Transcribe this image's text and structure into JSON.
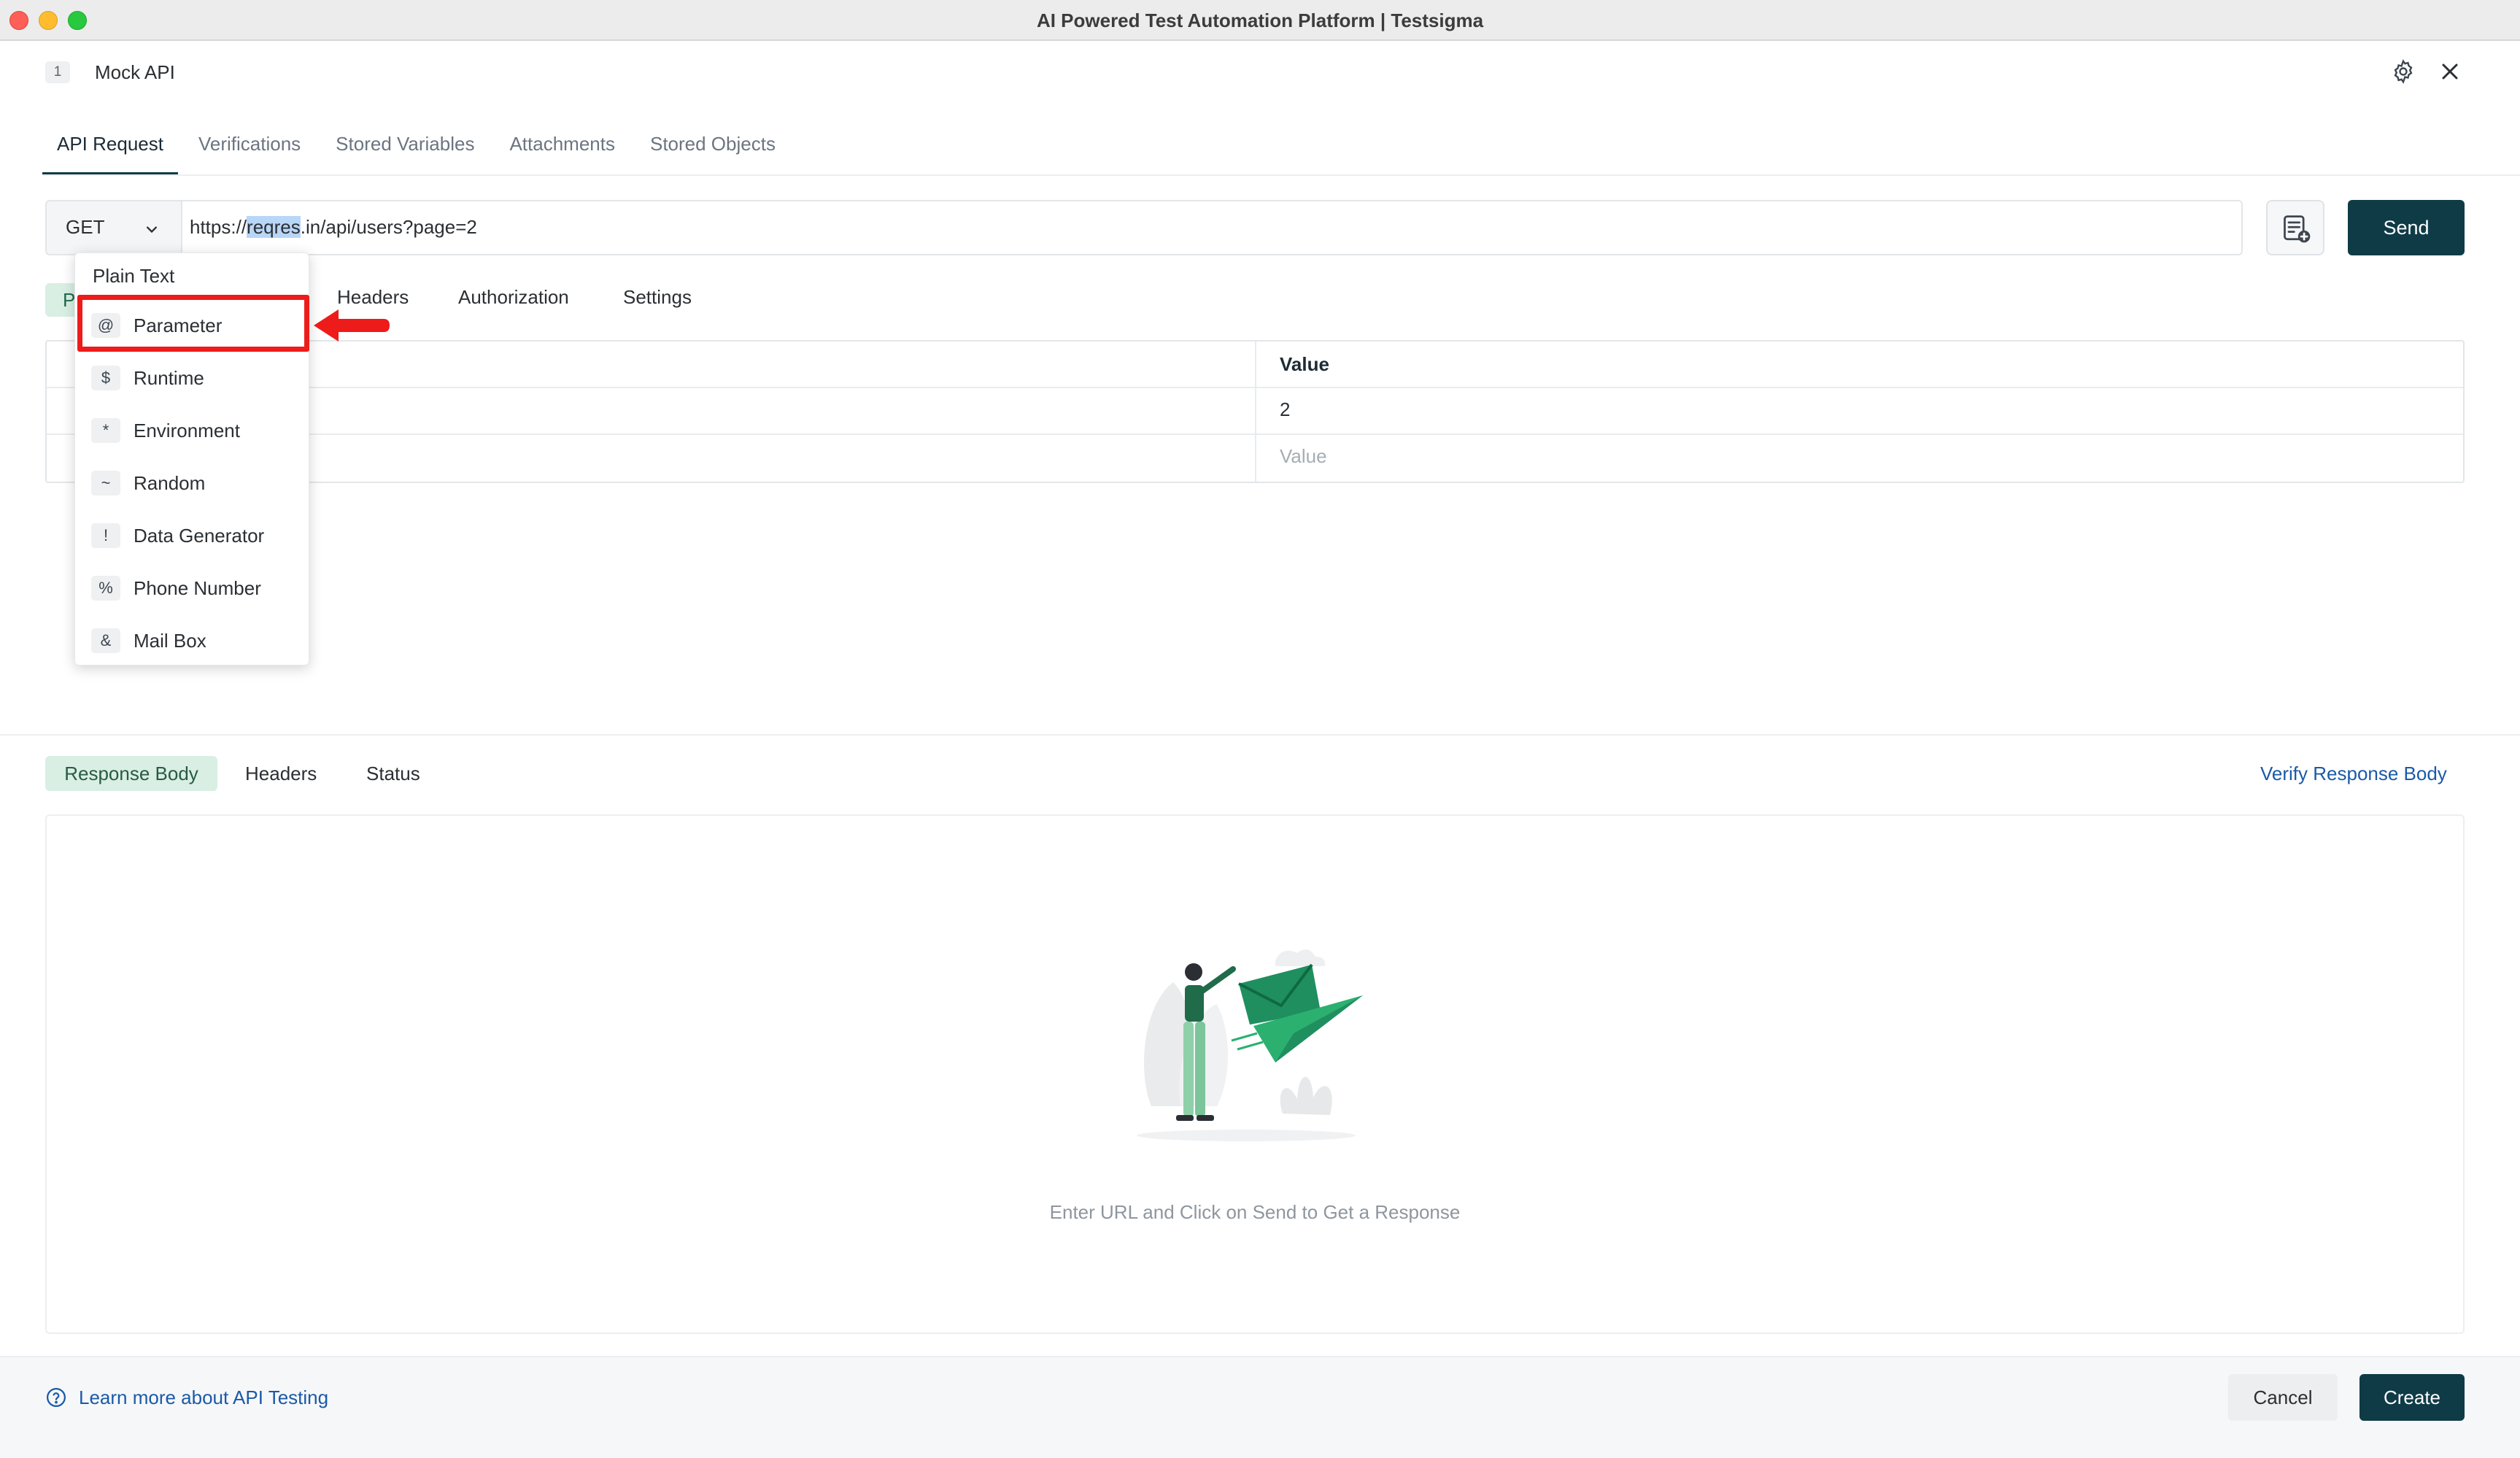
{
  "window": {
    "title": "AI Powered Test Automation Platform | Testsigma"
  },
  "header": {
    "step_number": "1",
    "step_title": "Mock API"
  },
  "main_tabs": [
    {
      "label": "API Request"
    },
    {
      "label": "Verifications"
    },
    {
      "label": "Stored Variables"
    },
    {
      "label": "Attachments"
    },
    {
      "label": "Stored Objects"
    }
  ],
  "request": {
    "method": "GET",
    "url_prefix": "https://",
    "url_selected": "reqres",
    "url_suffix": ".in/api/users?page=2",
    "send_label": "Send"
  },
  "sub_tabs": {
    "params_peek": "P",
    "headers": "Headers",
    "authorization": "Authorization",
    "settings": "Settings"
  },
  "params_table": {
    "value_header": "Value",
    "rows": [
      {
        "value": "2"
      }
    ],
    "value_placeholder": "Value"
  },
  "dropdown": {
    "header": "Plain Text",
    "items": [
      {
        "glyph": "@",
        "label": "Parameter"
      },
      {
        "glyph": "$",
        "label": "Runtime"
      },
      {
        "glyph": "*",
        "label": "Environment"
      },
      {
        "glyph": "~",
        "label": "Random"
      },
      {
        "glyph": "!",
        "label": "Data Generator"
      },
      {
        "glyph": "%",
        "label": "Phone Number"
      },
      {
        "glyph": "&",
        "label": "Mail Box"
      }
    ]
  },
  "response": {
    "tabs": [
      {
        "label": "Response Body"
      },
      {
        "label": "Headers"
      },
      {
        "label": "Status"
      }
    ],
    "verify_label": "Verify Response Body",
    "empty_message": "Enter URL and Click on Send to Get a Response"
  },
  "footer": {
    "learn_label": "Learn more about API Testing",
    "cancel_label": "Cancel",
    "create_label": "Create"
  },
  "colors": {
    "primary": "#0f3b47",
    "accent_green": "#1f8f5f",
    "link": "#1a5aa8",
    "highlight_red": "#ee1b1b"
  },
  "icons": {
    "settings": "gear-icon",
    "close": "close-icon",
    "snippet": "code-snippet-icon",
    "help": "question-circle-icon"
  }
}
